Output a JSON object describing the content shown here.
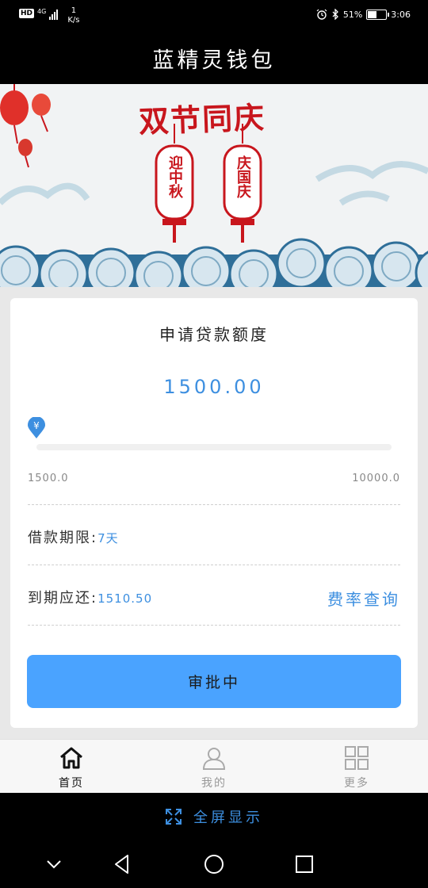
{
  "status_bar": {
    "hd": "HD",
    "network": "4G",
    "speed_value": "1",
    "speed_unit": "K/s",
    "battery_percent": "51%",
    "battery_level": 0.51,
    "time": "3:06"
  },
  "app": {
    "title": "蓝精灵钱包"
  },
  "banner": {
    "heading": "双节同庆",
    "lantern_left": "迎中秋",
    "lantern_right": "庆国庆"
  },
  "loan": {
    "title": "申请贷款额度",
    "amount": "1500.00",
    "slider_icon": "yen-icon",
    "slider_value": 1500,
    "slider_min": 1500,
    "slider_max": 10000,
    "min_label": "1500.0",
    "max_label": "10000.0",
    "term_label": "借款期限:",
    "term_value": "7天",
    "due_label": "到期应还:",
    "due_value": "1510.50",
    "fee_link": "费率查询",
    "button": "审批中"
  },
  "bottom_nav": [
    {
      "label": "首页",
      "icon": "home-icon",
      "active": true
    },
    {
      "label": "我的",
      "icon": "user-icon",
      "active": false
    },
    {
      "label": "更多",
      "icon": "grid-icon",
      "active": false
    }
  ],
  "fullscreen": {
    "icon": "expand-icon",
    "label": "全屏显示"
  },
  "system_nav": {
    "icons": [
      "chevron-down-icon",
      "back-triangle-icon",
      "home-circle-icon",
      "recents-square-icon"
    ]
  },
  "colors": {
    "accent": "#3d8fe0",
    "button": "#4aa3ff",
    "festive_red": "#c8161d"
  }
}
